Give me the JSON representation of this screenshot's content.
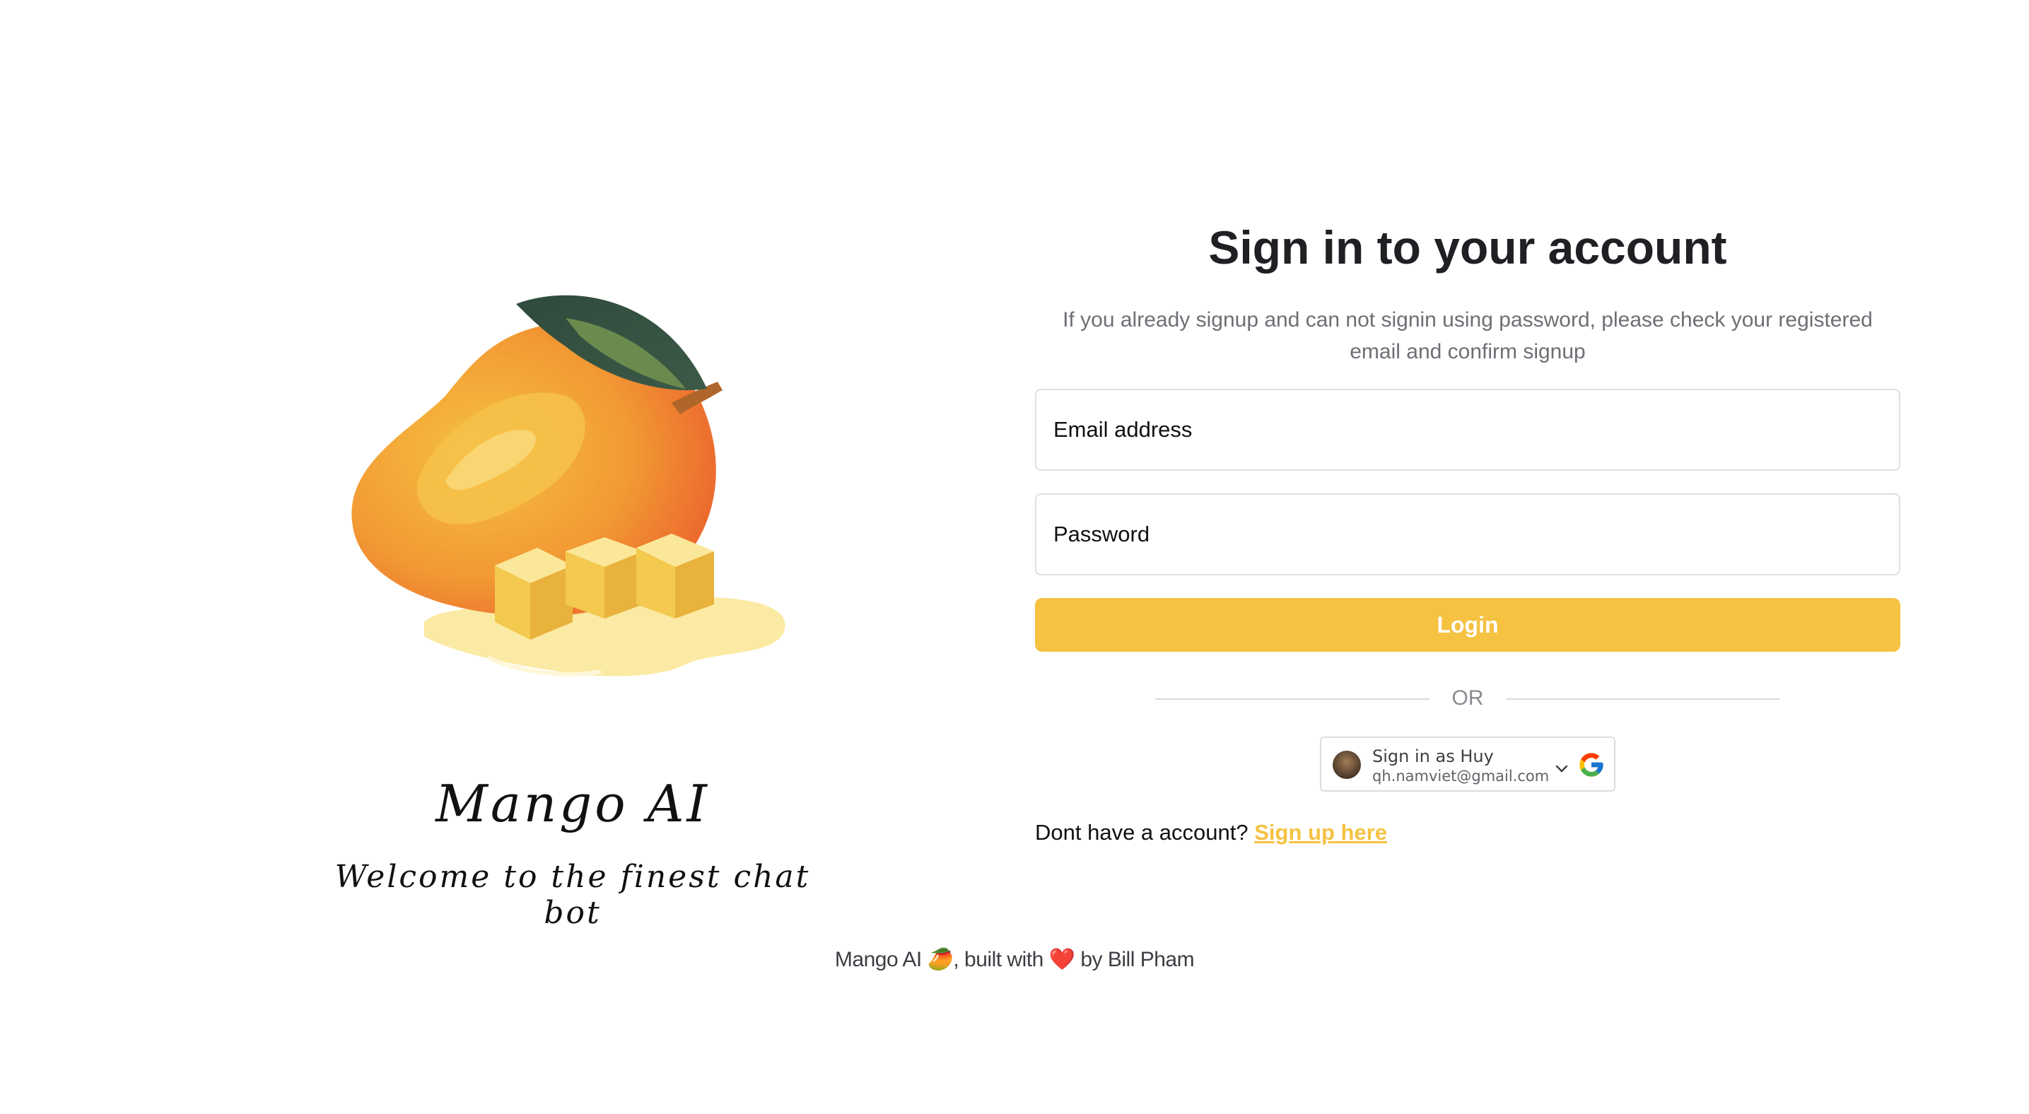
{
  "brand": {
    "title": "Mango AI",
    "tagline": "Welcome to the finest chat bot"
  },
  "form": {
    "title": "Sign in to your account",
    "subtitle": "If you already signup and can not signin using password, please check your registered email and confirm signup",
    "email_placeholder": "Email address",
    "password_placeholder": "Password",
    "login_label": "Login",
    "divider_label": "OR",
    "google": {
      "name_line": "Sign in as Huy",
      "email": "qh.namviet@gmail.com"
    },
    "signup_prompt": "Dont have a account?",
    "signup_link": "Sign up here"
  },
  "footer": {
    "part1": "Mango AI",
    "mango_emoji": "🥭",
    "part2": ", built with",
    "heart_emoji": "❤️",
    "part3": "by Bill Pham"
  },
  "colors": {
    "accent": "#f5c242",
    "text": "#1f2024",
    "muted": "#6e6f75"
  }
}
